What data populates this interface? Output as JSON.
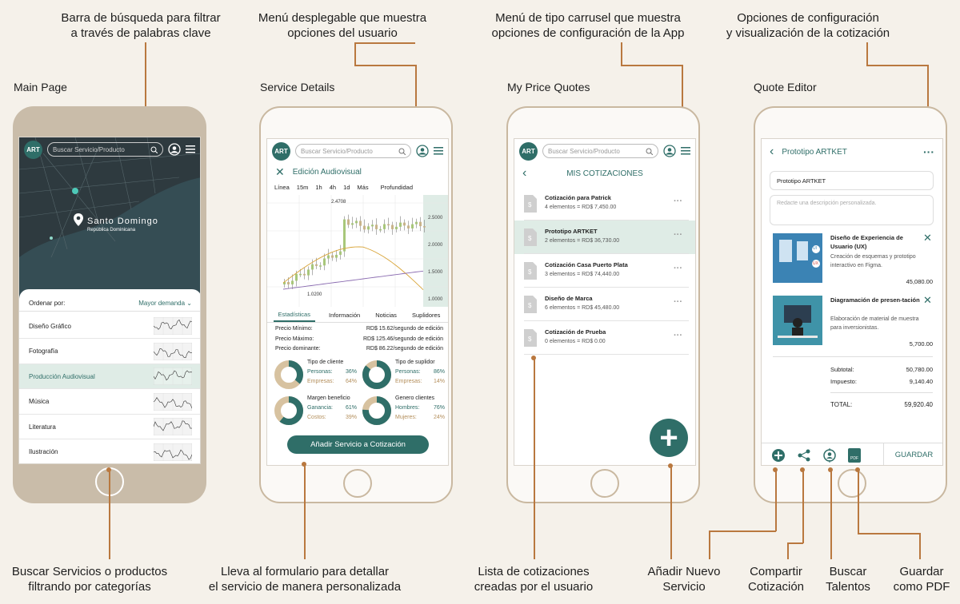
{
  "annotations": {
    "search": "Barra de búsqueda para filtrar\na través de palabras clave",
    "user_menu": "Menú desplegable que muestra\nopciones del usuario",
    "carousel": "Menú de tipo carrusel que muestra\nopciones de configuración de la App",
    "config": "Opciones de configuración\ny visualización de la cotización",
    "categories": "Buscar Servicios o productos\nfiltrando por categorías",
    "form": "Lleva al formulario para detallar\nel servicio de manera personalizada",
    "list": "Lista de cotizaciones\ncreadas por el usuario",
    "new_service": "Añadir Nuevo\nServicio",
    "share": "Compartir\nCotización",
    "talents": "Buscar\nTalentos",
    "pdf": "Guardar\ncomo PDF"
  },
  "screen_titles": [
    "Main Page",
    "Service Details",
    "My Price Quotes",
    "Quote Editor"
  ],
  "common": {
    "logo": "ART",
    "search_placeholder": "Buscar Servicio/Producto"
  },
  "main": {
    "city": "Santo Domingo",
    "country": "República Dominicana",
    "sort_label": "Ordenar por:",
    "sort_value": "Mayor demanda",
    "categories": [
      "Diseño Gráfico",
      "Fotografía",
      "Producción Audiovisual",
      "Música",
      "Literatura",
      "Ilustración"
    ]
  },
  "details": {
    "title": "Edición Audiovisual",
    "ranges": [
      "Línea",
      "15m",
      "1h",
      "4h",
      "1d",
      "Más",
      "Profundidad"
    ],
    "price_ticks": [
      "2.5000",
      "2.0000",
      "1.5000",
      "1.0000"
    ],
    "high_label": "2.4708",
    "low_label": "1.0200",
    "tabs": [
      "Estadísticas",
      "Información",
      "Noticias",
      "Suplidores"
    ],
    "stats": [
      {
        "label": "Precio Mínimo:",
        "value": "RD$ 15.62/segundo de edición"
      },
      {
        "label": "Precio Máximo:",
        "value": "RD$ 125.46/segundo de edición"
      },
      {
        "label": "Precio dominante:",
        "value": "RD$ 86.22/segundo de edición"
      }
    ],
    "donuts": [
      {
        "title": "Tipo de cliente",
        "a_label": "Personas:",
        "a_value": "36%",
        "b_label": "Empresas:",
        "b_value": "64%",
        "fraction": 0.36
      },
      {
        "title": "Tipo de suplidor",
        "a_label": "Personas:",
        "a_value": "86%",
        "b_label": "Empresas:",
        "b_value": "14%",
        "fraction": 0.86
      },
      {
        "title": "Margen beneficio",
        "a_label": "Ganancia:",
        "a_value": "61%",
        "b_label": "Costos:",
        "b_value": "39%",
        "fraction": 0.61
      },
      {
        "title": "Genero clientes",
        "a_label": "Hombres:",
        "a_value": "76%",
        "b_label": "Mujeres:",
        "b_value": "24%",
        "fraction": 0.76
      }
    ],
    "add_button": "Añadir Servicio a Cotización"
  },
  "quotes": {
    "title": "MIS COTIZACIONES",
    "items": [
      {
        "name": "Cotización para Patrick",
        "meta": "4 elementos = RD$ 7,450.00"
      },
      {
        "name": "Prototipo ARTKET",
        "meta": "2 elementos = RD$ 36,730.00"
      },
      {
        "name": "Cotización Casa Puerto Plata",
        "meta": "3 elementos = RD$ 74,440.00"
      },
      {
        "name": "Diseño de Marca",
        "meta": "6 elementos = RD$ 45,480.00"
      },
      {
        "name": "Cotización de Prueba",
        "meta": "0 elementos = RD$ 0.00"
      }
    ],
    "fab": "+"
  },
  "editor": {
    "title": "Prototipo ARTKET",
    "name_value": "Prototipo ARTKET",
    "desc_placeholder": "Redacte una descripción personalizada.",
    "items": [
      {
        "title": "Diseño de Experiencia de Usuario (UX)",
        "desc": "Creación de esquemas y prototipo interactivo en Figma.",
        "price": "45,080.00",
        "ui": "UI",
        "ux": "UX"
      },
      {
        "title": "Diagramación de presen-tación",
        "desc": "Elaboración de material de muestra para inversionistas.",
        "price": "5,700.00"
      }
    ],
    "subtotal_label": "Subtotal:",
    "subtotal": "50,780.00",
    "tax_label": "Impuesto:",
    "tax": "9,140.40",
    "total_label": "TOTAL:",
    "total": "59,920.40",
    "save": "GUARDAR",
    "pdf_badge": "PDF"
  },
  "colors": {
    "accent": "#2f6e68",
    "annotation_line": "#b9783f",
    "highlight": "#dfece6"
  }
}
